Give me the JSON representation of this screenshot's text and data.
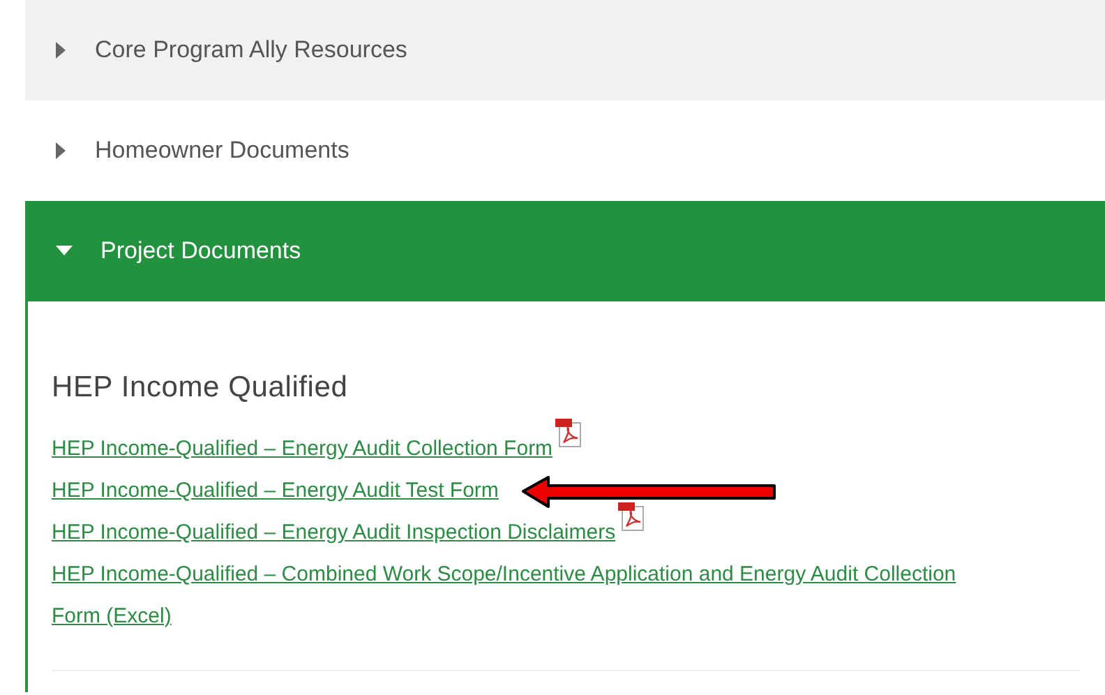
{
  "accordion": [
    {
      "title": "Core Program Ally Resources",
      "expanded": false,
      "shaded": true
    },
    {
      "title": "Homeowner Documents",
      "expanded": false,
      "shaded": false
    },
    {
      "title": "Project Documents",
      "expanded": true,
      "shaded": false
    }
  ],
  "section": {
    "heading": "HEP Income Qualified",
    "links": [
      {
        "label": "HEP Income-Qualified – Energy Audit Collection Form",
        "kind": "pdf",
        "pointed": false
      },
      {
        "label": "HEP Income-Qualified – Energy Audit Test Form",
        "kind": "plain",
        "pointed": true
      },
      {
        "label": "HEP Income-Qualified – Energy Audit Inspection Disclaimers",
        "kind": "pdf",
        "pointed": false
      },
      {
        "label": "HEP Income-Qualified – Combined Work Scope/Incentive Application and Energy Audit Collection Form (Excel)",
        "kind": "plain",
        "pointed": false
      }
    ]
  }
}
